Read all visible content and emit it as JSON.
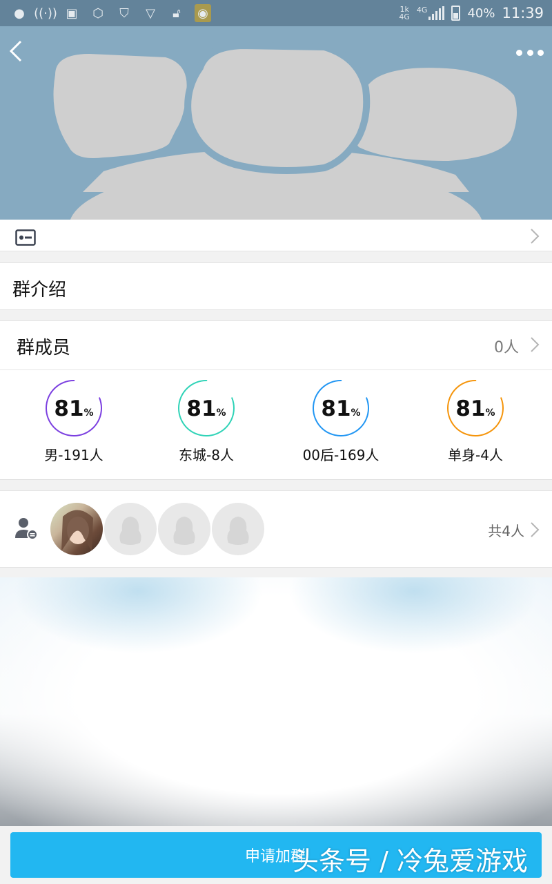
{
  "status_bar": {
    "network_small": "1k",
    "network_small_2": "4G",
    "network": "4G",
    "battery": "40%",
    "time": "11:39",
    "icons": [
      "record-icon",
      "wifi-hotspot-icon",
      "image-icon",
      "settings-hex-icon",
      "shield-icon",
      "shield-small-icon",
      "lock-icon",
      "app-icon"
    ]
  },
  "header": {
    "back_icon": "chevron-left-icon",
    "more_icon": "more-dots-icon",
    "background_color": "#86aac1"
  },
  "card_row": {
    "icon": "id-card-icon"
  },
  "intro": {
    "label": "群介绍"
  },
  "members": {
    "label": "群成员",
    "count": "0人",
    "stats": [
      {
        "percent": "81",
        "unit": "%",
        "caption": "男-191人",
        "color": "#7b3fe0",
        "fill": 0.81
      },
      {
        "percent": "81",
        "unit": "%",
        "caption": "东城-8人",
        "color": "#2fd3b7",
        "fill": 0.81
      },
      {
        "percent": "81",
        "unit": "%",
        "caption": "00后-169人",
        "color": "#2196f3",
        "fill": 0.81
      },
      {
        "percent": "81",
        "unit": "%",
        "caption": "单身-4人",
        "color": "#f5940a",
        "fill": 0.81
      }
    ]
  },
  "admins": {
    "icon": "admin-user-icon",
    "total": "共4人"
  },
  "footer": {
    "join_label": "申请加群",
    "watermark": "头条号 / 冷兔爱游戏",
    "button_color": "#22b7f1"
  }
}
